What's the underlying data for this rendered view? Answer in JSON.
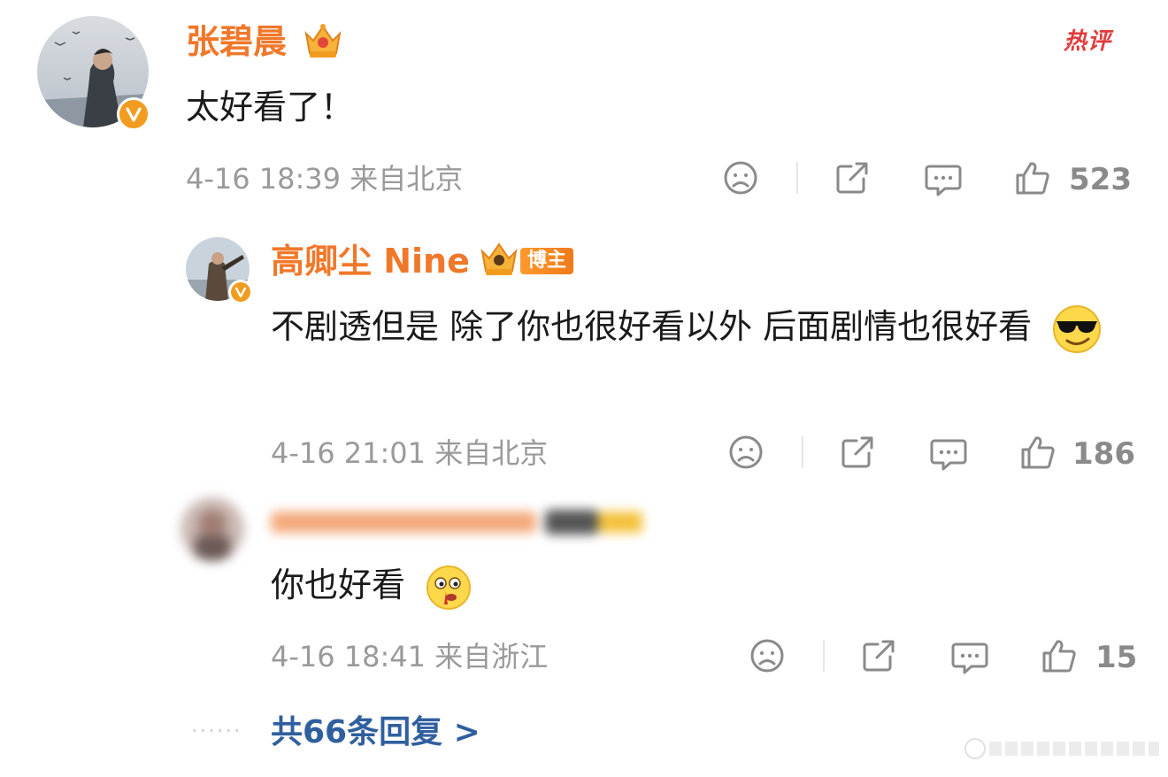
{
  "main_comment": {
    "username": "张碧晨",
    "tag": "热评",
    "text": "太好看了！",
    "meta": "4-16 18:39 来自北京",
    "likes": "523"
  },
  "replies": [
    {
      "username": "高卿尘 Nine",
      "badge": "博主",
      "text": "不剧透但是 除了你也很好看以外 后面剧情也很好看",
      "emoji_icon": "sunglasses-smile-icon",
      "meta": "4-16 21:01 来自北京",
      "likes": "186"
    },
    {
      "username": "",
      "text": "你也好看",
      "emoji_icon": "nosebleed-face-icon",
      "meta": "4-16 18:41 来自浙江",
      "likes": "15"
    }
  ],
  "more_replies": {
    "label": "共66条回复 >"
  },
  "colors": {
    "username": "#f0782a",
    "link": "#2f5f9e",
    "meta": "#9a9a9a",
    "verified": "#f29c1f"
  }
}
